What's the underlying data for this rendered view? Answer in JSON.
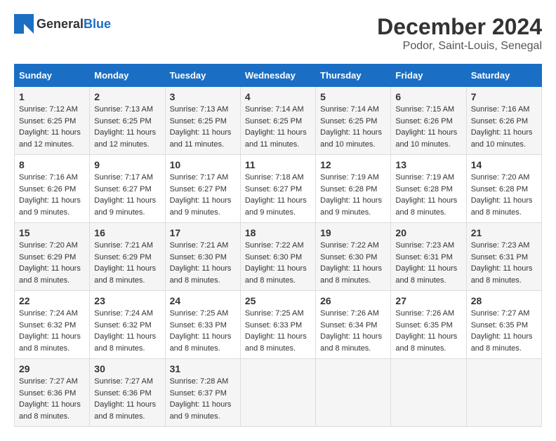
{
  "header": {
    "logo_general": "General",
    "logo_blue": "Blue",
    "month_title": "December 2024",
    "location": "Podor, Saint-Louis, Senegal"
  },
  "weekdays": [
    "Sunday",
    "Monday",
    "Tuesday",
    "Wednesday",
    "Thursday",
    "Friday",
    "Saturday"
  ],
  "weeks": [
    [
      {
        "day": "1",
        "sunrise": "7:12 AM",
        "sunset": "6:25 PM",
        "daylight": "11 hours and 12 minutes."
      },
      {
        "day": "2",
        "sunrise": "7:13 AM",
        "sunset": "6:25 PM",
        "daylight": "11 hours and 12 minutes."
      },
      {
        "day": "3",
        "sunrise": "7:13 AM",
        "sunset": "6:25 PM",
        "daylight": "11 hours and 11 minutes."
      },
      {
        "day": "4",
        "sunrise": "7:14 AM",
        "sunset": "6:25 PM",
        "daylight": "11 hours and 11 minutes."
      },
      {
        "day": "5",
        "sunrise": "7:14 AM",
        "sunset": "6:25 PM",
        "daylight": "11 hours and 10 minutes."
      },
      {
        "day": "6",
        "sunrise": "7:15 AM",
        "sunset": "6:26 PM",
        "daylight": "11 hours and 10 minutes."
      },
      {
        "day": "7",
        "sunrise": "7:16 AM",
        "sunset": "6:26 PM",
        "daylight": "11 hours and 10 minutes."
      }
    ],
    [
      {
        "day": "8",
        "sunrise": "7:16 AM",
        "sunset": "6:26 PM",
        "daylight": "11 hours and 9 minutes."
      },
      {
        "day": "9",
        "sunrise": "7:17 AM",
        "sunset": "6:27 PM",
        "daylight": "11 hours and 9 minutes."
      },
      {
        "day": "10",
        "sunrise": "7:17 AM",
        "sunset": "6:27 PM",
        "daylight": "11 hours and 9 minutes."
      },
      {
        "day": "11",
        "sunrise": "7:18 AM",
        "sunset": "6:27 PM",
        "daylight": "11 hours and 9 minutes."
      },
      {
        "day": "12",
        "sunrise": "7:19 AM",
        "sunset": "6:28 PM",
        "daylight": "11 hours and 9 minutes."
      },
      {
        "day": "13",
        "sunrise": "7:19 AM",
        "sunset": "6:28 PM",
        "daylight": "11 hours and 8 minutes."
      },
      {
        "day": "14",
        "sunrise": "7:20 AM",
        "sunset": "6:28 PM",
        "daylight": "11 hours and 8 minutes."
      }
    ],
    [
      {
        "day": "15",
        "sunrise": "7:20 AM",
        "sunset": "6:29 PM",
        "daylight": "11 hours and 8 minutes."
      },
      {
        "day": "16",
        "sunrise": "7:21 AM",
        "sunset": "6:29 PM",
        "daylight": "11 hours and 8 minutes."
      },
      {
        "day": "17",
        "sunrise": "7:21 AM",
        "sunset": "6:30 PM",
        "daylight": "11 hours and 8 minutes."
      },
      {
        "day": "18",
        "sunrise": "7:22 AM",
        "sunset": "6:30 PM",
        "daylight": "11 hours and 8 minutes."
      },
      {
        "day": "19",
        "sunrise": "7:22 AM",
        "sunset": "6:30 PM",
        "daylight": "11 hours and 8 minutes."
      },
      {
        "day": "20",
        "sunrise": "7:23 AM",
        "sunset": "6:31 PM",
        "daylight": "11 hours and 8 minutes."
      },
      {
        "day": "21",
        "sunrise": "7:23 AM",
        "sunset": "6:31 PM",
        "daylight": "11 hours and 8 minutes."
      }
    ],
    [
      {
        "day": "22",
        "sunrise": "7:24 AM",
        "sunset": "6:32 PM",
        "daylight": "11 hours and 8 minutes."
      },
      {
        "day": "23",
        "sunrise": "7:24 AM",
        "sunset": "6:32 PM",
        "daylight": "11 hours and 8 minutes."
      },
      {
        "day": "24",
        "sunrise": "7:25 AM",
        "sunset": "6:33 PM",
        "daylight": "11 hours and 8 minutes."
      },
      {
        "day": "25",
        "sunrise": "7:25 AM",
        "sunset": "6:33 PM",
        "daylight": "11 hours and 8 minutes."
      },
      {
        "day": "26",
        "sunrise": "7:26 AM",
        "sunset": "6:34 PM",
        "daylight": "11 hours and 8 minutes."
      },
      {
        "day": "27",
        "sunrise": "7:26 AM",
        "sunset": "6:35 PM",
        "daylight": "11 hours and 8 minutes."
      },
      {
        "day": "28",
        "sunrise": "7:27 AM",
        "sunset": "6:35 PM",
        "daylight": "11 hours and 8 minutes."
      }
    ],
    [
      {
        "day": "29",
        "sunrise": "7:27 AM",
        "sunset": "6:36 PM",
        "daylight": "11 hours and 8 minutes."
      },
      {
        "day": "30",
        "sunrise": "7:27 AM",
        "sunset": "6:36 PM",
        "daylight": "11 hours and 8 minutes."
      },
      {
        "day": "31",
        "sunrise": "7:28 AM",
        "sunset": "6:37 PM",
        "daylight": "11 hours and 9 minutes."
      },
      {
        "day": "",
        "sunrise": "",
        "sunset": "",
        "daylight": ""
      },
      {
        "day": "",
        "sunrise": "",
        "sunset": "",
        "daylight": ""
      },
      {
        "day": "",
        "sunrise": "",
        "sunset": "",
        "daylight": ""
      },
      {
        "day": "",
        "sunrise": "",
        "sunset": "",
        "daylight": ""
      }
    ]
  ],
  "labels": {
    "sunrise_prefix": "Sunrise: ",
    "sunset_prefix": "Sunset: ",
    "daylight_prefix": "Daylight: "
  }
}
